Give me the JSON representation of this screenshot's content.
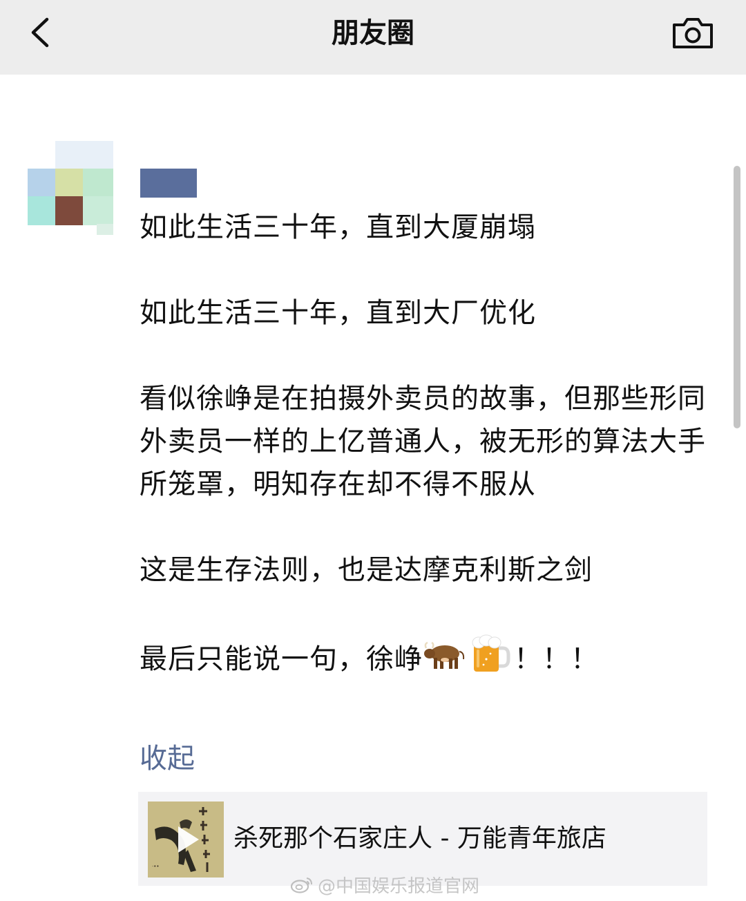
{
  "nav": {
    "title": "朋友圈",
    "back_icon": "chevron-left-icon",
    "camera_icon": "camera-icon",
    "background": "#ededed"
  },
  "post": {
    "paragraphs": [
      "如此生活三十年，直到大厦崩塌",
      "如此生活三十年，直到大厂优化",
      "看似徐峥是在拍摄外卖员的故事，但那些形同外卖员一样的上亿普通人，被无形的算法大手所笼罩，明知存在却不得不服从",
      "这是生存法则，也是达摩克利斯之剑"
    ],
    "last_line": {
      "prefix": "最后只能说一句，徐峥",
      "emojis": [
        "ox-emoji",
        "beer-emoji"
      ],
      "suffix": "！！！"
    },
    "collapse_label": "收起",
    "link_color": "#576b95"
  },
  "music_card": {
    "title": "杀死那个石家庄人 - 万能青年旅店",
    "cover_icon": "album-cover",
    "play_icon": "play-icon"
  },
  "watermark": {
    "text": "@中国娱乐报道官网",
    "logo": "weibo-logo"
  }
}
